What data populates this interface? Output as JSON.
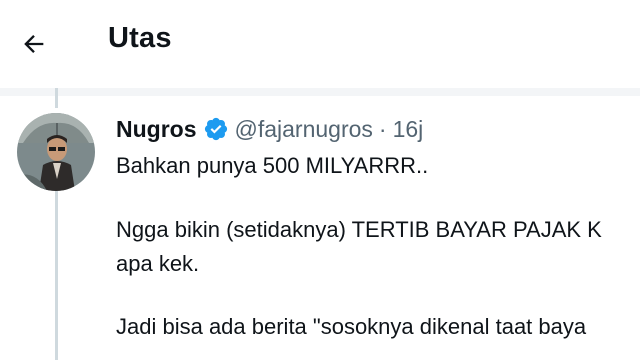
{
  "header": {
    "back_icon": "arrow-left-icon",
    "title": "Utas"
  },
  "tweet": {
    "author": {
      "display_name": "Nugros",
      "handle": "@fajarnugros",
      "verified": true,
      "verified_color": "#1d9bf0"
    },
    "separator": "·",
    "time": "16j",
    "lines": [
      "Bahkan punya 500 MILYARRR..",
      "Ngga bikin (setidaknya) TERTIB BAYAR PAJAK K",
      "apa kek.",
      "Jadi bisa ada berita \"sosoknya dikenal taat baya"
    ]
  },
  "colors": {
    "text_primary": "#0f1419",
    "text_secondary": "#536471",
    "thread_line": "#cfd9de",
    "divider": "#f3f5f7"
  }
}
